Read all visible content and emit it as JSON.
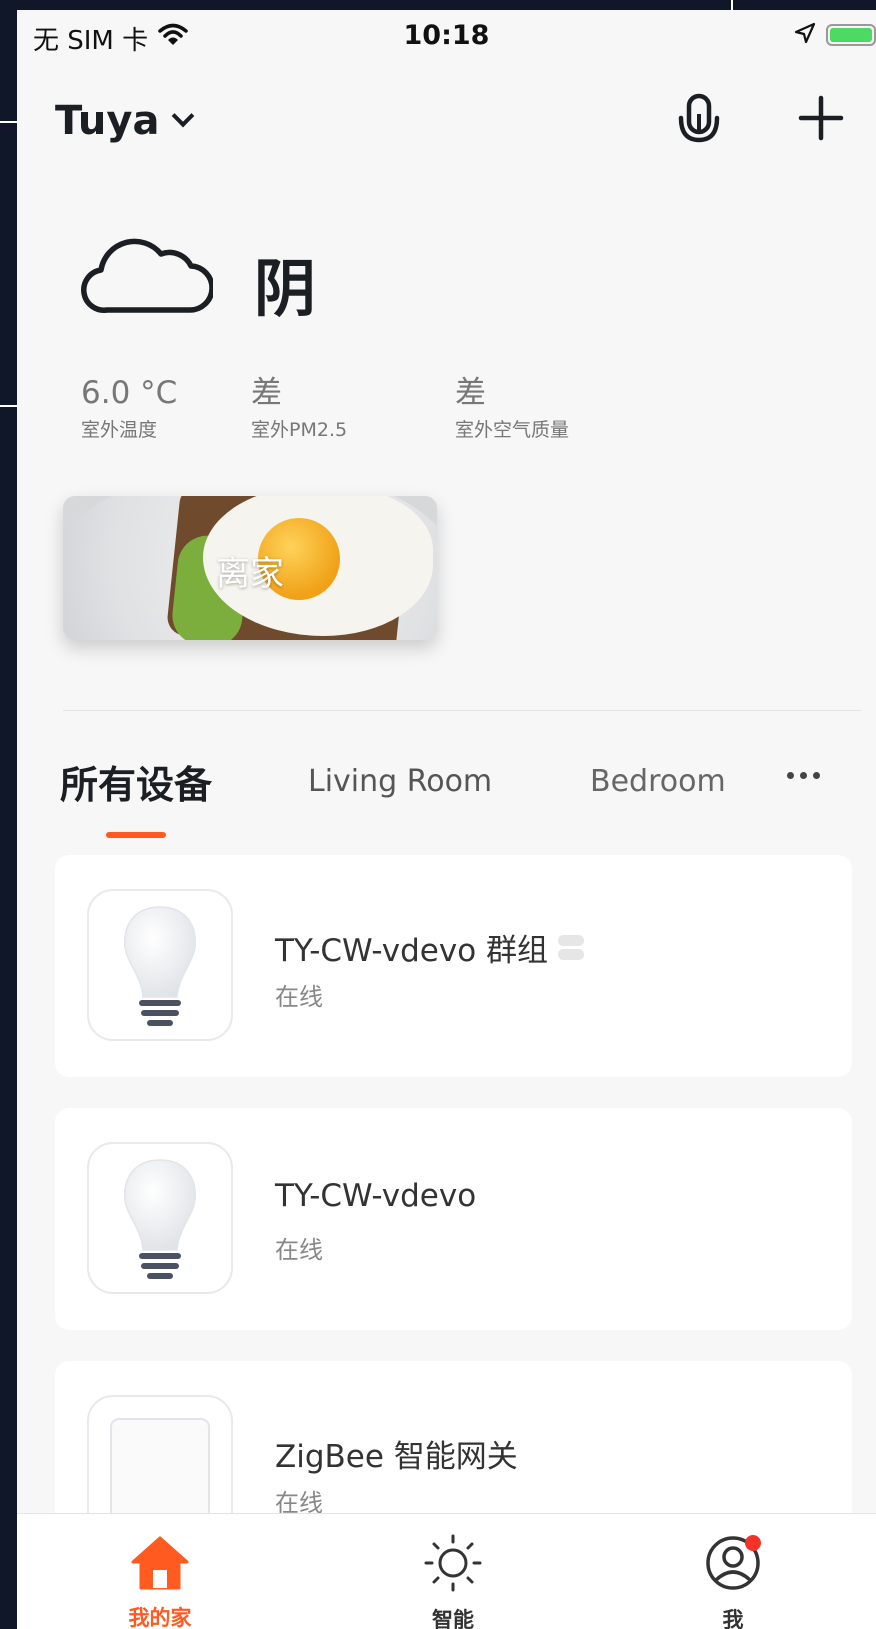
{
  "status_bar": {
    "carrier": "无 SIM 卡",
    "time": "10:18",
    "battery_level": 1.0,
    "battery_color": "#4cd964"
  },
  "header": {
    "home_name": "Tuya",
    "mic_icon": "microphone-icon",
    "add_icon": "plus-icon"
  },
  "weather": {
    "icon": "cloud-icon",
    "condition": "阴",
    "metrics": [
      {
        "value": "6.0 °C",
        "label": "室外温度"
      },
      {
        "value": "差",
        "label": "室外PM2.5"
      },
      {
        "value": "差",
        "label": "室外空气质量"
      }
    ]
  },
  "scene": {
    "name": "离家"
  },
  "tabs": {
    "items": [
      "所有设备",
      "Living Room",
      "Bedroom"
    ],
    "active_index": 0,
    "accent_color": "#ff5a1f"
  },
  "devices": [
    {
      "name": "TY-CW-vdevo 群组",
      "status": "在线",
      "icon": "light-bulb-icon",
      "is_group": true
    },
    {
      "name": "TY-CW-vdevo",
      "status": "在线",
      "icon": "light-bulb-icon",
      "is_group": false
    },
    {
      "name": "ZigBee 智能网关",
      "status": "在线",
      "icon": "gateway-icon",
      "is_group": false
    }
  ],
  "bottom_nav": {
    "items": [
      {
        "label": "我的家",
        "icon": "home-icon"
      },
      {
        "label": "智能",
        "icon": "sun-icon"
      },
      {
        "label": "我",
        "icon": "user-icon"
      }
    ],
    "active_index": 0,
    "accent_color": "#ff5a1f",
    "notification_color": "#f5322a"
  }
}
